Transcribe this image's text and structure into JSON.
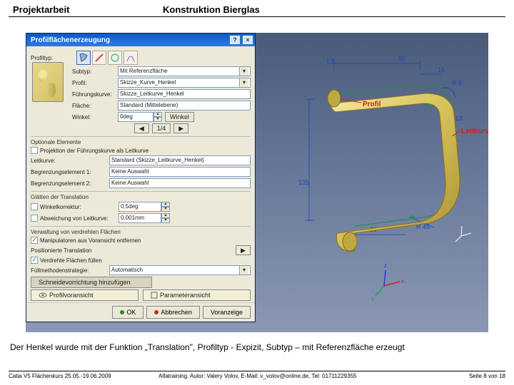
{
  "header": {
    "left": "Projektarbeit",
    "right": "Konstruktion   Bierglas"
  },
  "dialog": {
    "title": "Profilflächenerzeugung",
    "profiltyp_label": "Profiltyp:",
    "subtyp_label": "Subtyp:",
    "subtyp_value": "Mit Referenzfläche",
    "profil_label": "Profil:",
    "profil_value": "Skizze_Kurve_Henkel",
    "leitkurve_label": "Führungskurve:",
    "leitkurve_value": "Skizze_Leitkurve_Henkel",
    "flaeche_label": "Fläche:",
    "flaeche_value": "Standard (Mittelebene)",
    "winkel_label": "Winkel:",
    "winkel_value": "0deg",
    "winkel_btn1": "Winkel",
    "winkel_btn2": "1/4",
    "optionale": "Optionale Elemente",
    "chk_proj": "Projektion der Führungskurve als Leitkurve",
    "leitkurve2_label": "Leitkurve:",
    "leitkurve2_value": "Standard (Skizze_Leitkurve_Henkel)",
    "begr1_label": "Begrenzungselement 1:",
    "begr1_value": "Keine Auswahl",
    "begr2_label": "Begrenzungselement 2:",
    "begr2_value": "Keine Auswahl",
    "glatt_hdr": "Glätten der Translation",
    "winkelkorr_label": "Winkelkorrektur:",
    "winkelkorr_value": "0,5deg",
    "abw_label": "Abweichung von Leitkurve:",
    "abw_value": "0,001mm",
    "verw_hdr": "Verwaltung von verdrehten Flächen",
    "chk_manip": "Manipulatoren aus Voransicht entfernen",
    "pos_hdr": "Positionierte Translation",
    "chk_verdreht": "Verdrehte Flächen füllen",
    "strat_label": "Füllmethodenstrategie:",
    "strat_value": "Automatisch",
    "add_cutter": "Schneidevorrichtung hinzufügen",
    "ok": "OK",
    "cancel": "Abbrechen",
    "preview": "Voranzeige",
    "preview_icon_label": "Profilvoransicht",
    "param_label": "Parameteransicht"
  },
  "viewport": {
    "dim_80": "80",
    "dim_15": "15",
    "dim_r5": "R 5",
    "dim_135": "135",
    "dim_30": "30",
    "dim_r45": "R 45",
    "dim_l2": "L2",
    "dim_l3": "L3",
    "profil_label": "Profil",
    "leitkurve_label": "Leitkurve"
  },
  "caption": "Der Henkel wurde mit der Funktion „Translation\", Profiltyp - Expizit, Subtyp – mit Referenzfläche erzeugt",
  "footer": {
    "left": "Catia V5 Flächenkurs 25.05.-19.06.2009",
    "mid": "Alfatraining. Autor: Valery Volov, E-Mail: v_volov@online.de, Tel: 01711229355",
    "right": "Seite 8 von 18"
  }
}
